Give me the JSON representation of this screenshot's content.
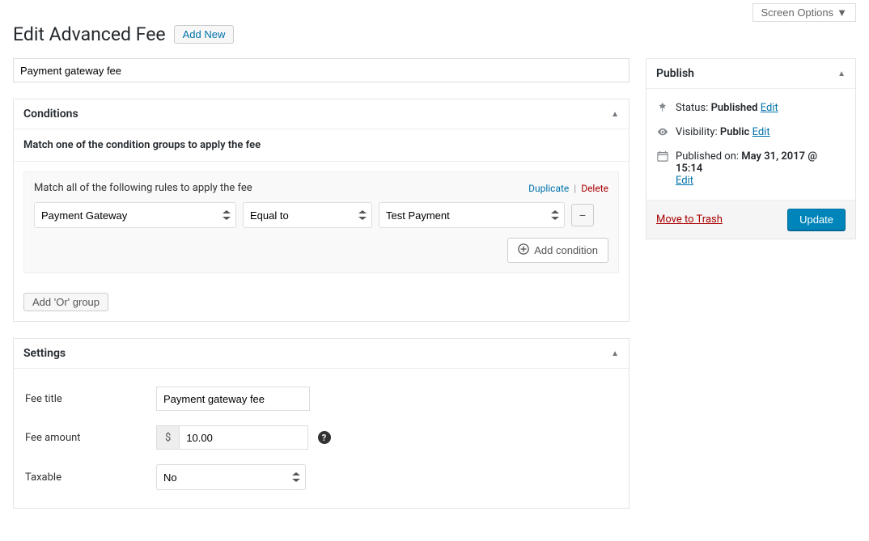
{
  "screenOptions": "Screen Options",
  "page": {
    "title": "Edit Advanced Fee",
    "addNew": "Add New"
  },
  "post": {
    "title": "Payment gateway fee"
  },
  "conditions": {
    "panelTitle": "Conditions",
    "intro": "Match one of the condition groups to apply the fee",
    "groupTitle": "Match all of the following rules to apply the fee",
    "duplicate": "Duplicate",
    "delete": "Delete",
    "row": {
      "field": "Payment Gateway",
      "operator": "Equal to",
      "value": "Test Payment"
    },
    "addCondition": "Add condition",
    "addOrGroup": "Add 'Or' group"
  },
  "settings": {
    "panelTitle": "Settings",
    "feeTitleLabel": "Fee title",
    "feeTitleValue": "Payment gateway fee",
    "feeAmountLabel": "Fee amount",
    "currency": "$",
    "feeAmountValue": "10.00",
    "taxableLabel": "Taxable",
    "taxableValue": "No"
  },
  "publish": {
    "panelTitle": "Publish",
    "statusLabel": "Status:",
    "statusValue": "Published",
    "visibilityLabel": "Visibility:",
    "visibilityValue": "Public",
    "publishedLabel": "Published on:",
    "publishedValue": "May 31, 2017 @ 15:14",
    "edit": "Edit",
    "trash": "Move to Trash",
    "update": "Update"
  }
}
